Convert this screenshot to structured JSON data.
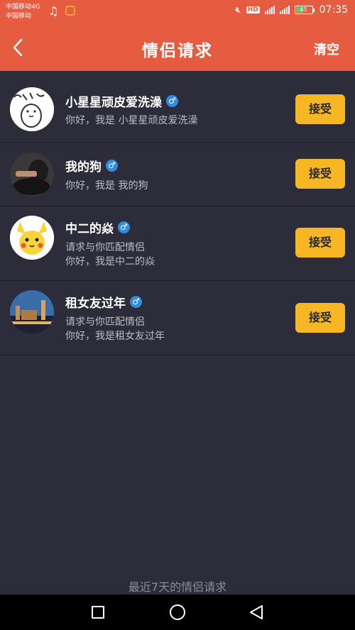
{
  "status_bar": {
    "carrier1": "中国移动4G",
    "carrier2": "中国移动",
    "hd": "HD",
    "battery": "45",
    "time": "07:35"
  },
  "header": {
    "title": "情侣请求",
    "clear_label": "清空"
  },
  "requests": [
    {
      "name": "小星星顽皮爱洗澡",
      "gender": "♂",
      "lines": [
        "你好，我是 小星星顽皮爱洗澡"
      ],
      "accept_label": "接受"
    },
    {
      "name": "我的狗",
      "gender": "♂",
      "lines": [
        "你好，我是 我的狗"
      ],
      "accept_label": "接受"
    },
    {
      "name": "中二的焱",
      "gender": "♂",
      "lines": [
        "请求与你匹配情侣",
        "你好，我是中二的焱"
      ],
      "accept_label": "接受"
    },
    {
      "name": "租女友过年",
      "gender": "♂",
      "lines": [
        "请求与你匹配情侣",
        "你好，我是租女友过年"
      ],
      "accept_label": "接受"
    }
  ],
  "footer_note": "最近7天的情侣请求",
  "colors": {
    "accent": "#e65c40",
    "background": "#2d2c3a",
    "button": "#f7b624",
    "male_badge": "#2f8ce0"
  }
}
